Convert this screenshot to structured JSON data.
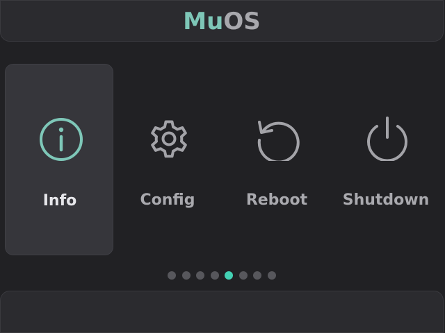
{
  "header": {
    "title_accent": "Mu",
    "title_rest": "OS"
  },
  "menu": {
    "selected_index": 0,
    "items": [
      {
        "label": "Info",
        "icon": "info-icon"
      },
      {
        "label": "Config",
        "icon": "gear-icon"
      },
      {
        "label": "Reboot",
        "icon": "reboot-icon"
      },
      {
        "label": "Shutdown",
        "icon": "power-icon"
      }
    ]
  },
  "pagination": {
    "total": 8,
    "active_index": 4
  },
  "colors": {
    "accent": "#7ec7b8",
    "active_dot": "#43d1b4",
    "icon_inactive": "#a3a3a8",
    "background": "#212124",
    "panel": "#2b2b2f",
    "selected_tile": "#36363b"
  }
}
